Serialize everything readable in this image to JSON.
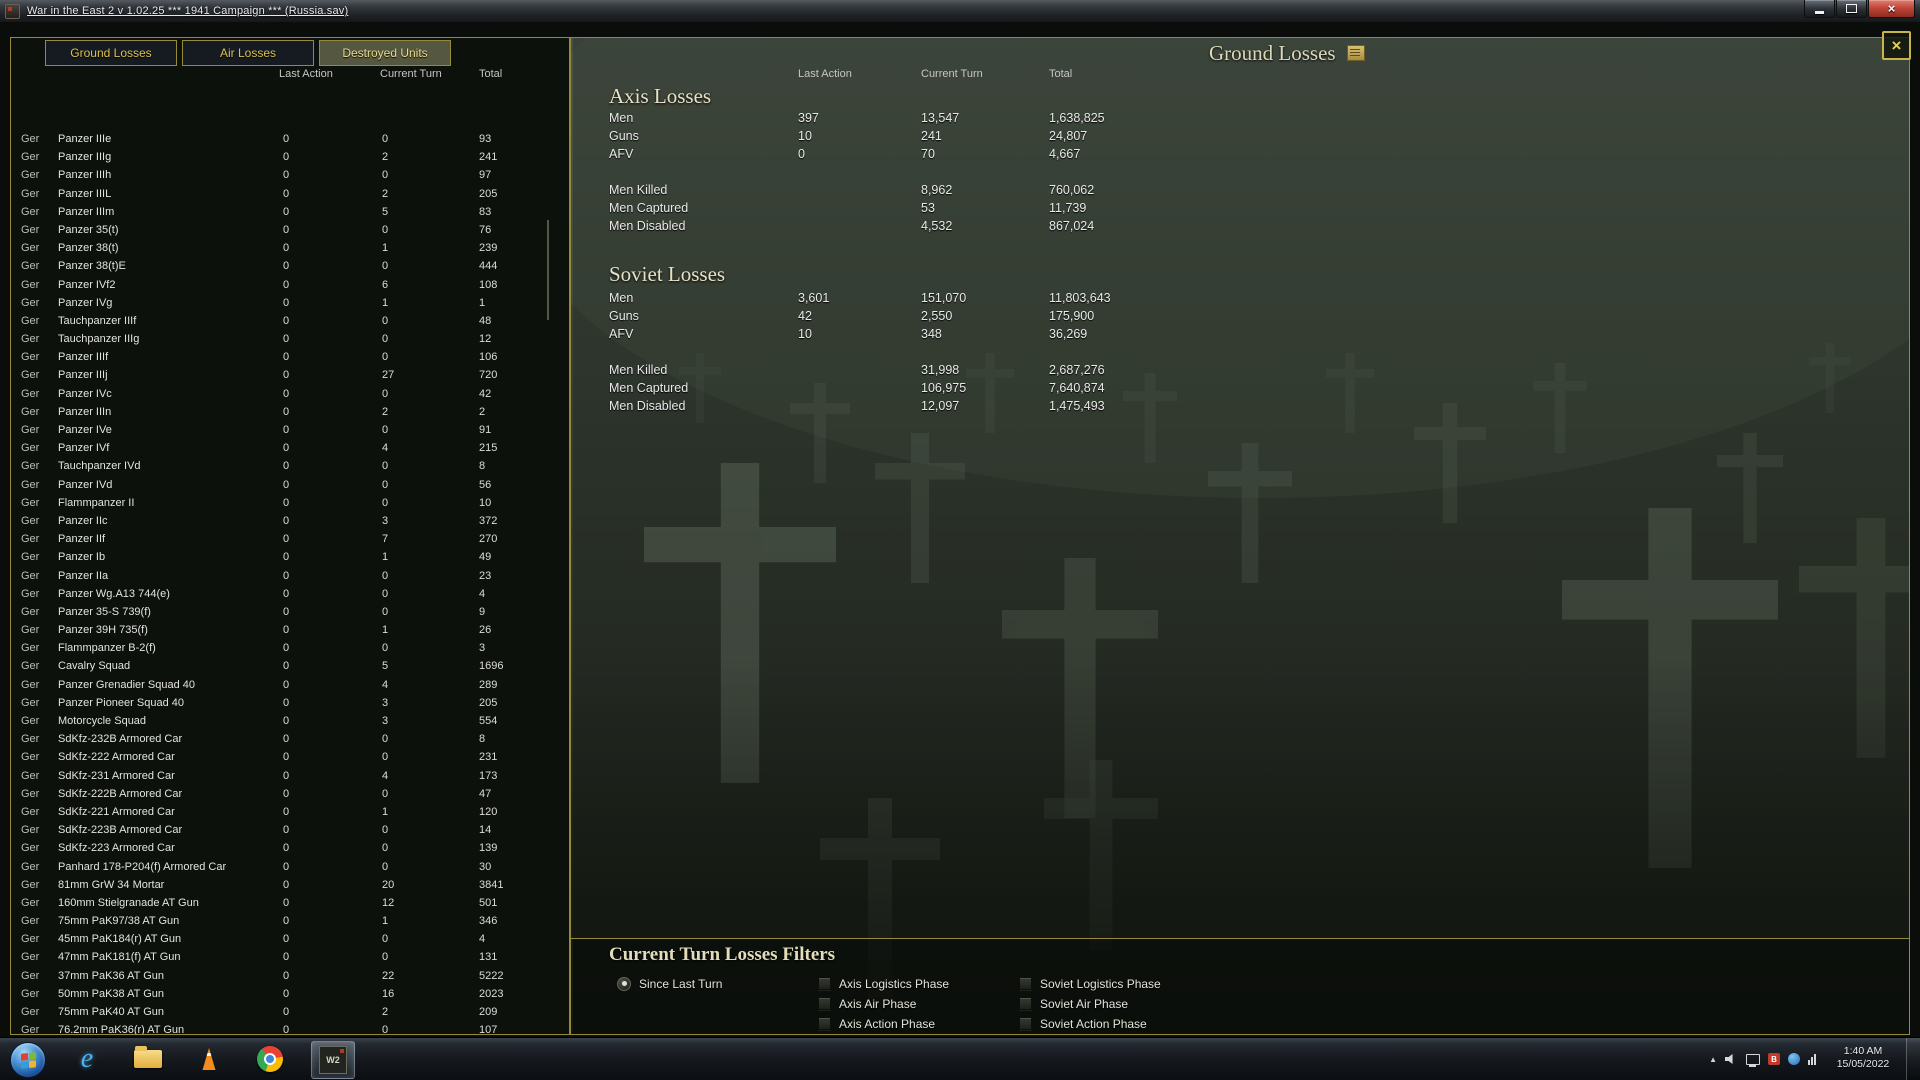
{
  "titlebar": {
    "title": "War in the East 2  v 1.02.25    ***    1941 Campaign    ***    (Russia.sav)"
  },
  "tabs": [
    "Ground Losses",
    "Air Losses",
    "Destroyed Units"
  ],
  "screen_title": "Ground Losses",
  "glyphs": {
    "screen_close": "×"
  },
  "left_table": {
    "headers": [
      "Last Action",
      "Current Turn",
      "Total"
    ],
    "rows": [
      [
        "Ger",
        "Panzer IIIe",
        "0",
        "0",
        "93"
      ],
      [
        "Ger",
        "Panzer IIIg",
        "0",
        "2",
        "241"
      ],
      [
        "Ger",
        "Panzer IIIh",
        "0",
        "0",
        "97"
      ],
      [
        "Ger",
        "Panzer IIIL",
        "0",
        "2",
        "205"
      ],
      [
        "Ger",
        "Panzer IIIm",
        "0",
        "5",
        "83"
      ],
      [
        "Ger",
        "Panzer 35(t)",
        "0",
        "0",
        "76"
      ],
      [
        "Ger",
        "Panzer 38(t)",
        "0",
        "1",
        "239"
      ],
      [
        "Ger",
        "Panzer 38(t)E",
        "0",
        "0",
        "444"
      ],
      [
        "Ger",
        "Panzer IVf2",
        "0",
        "6",
        "108"
      ],
      [
        "Ger",
        "Panzer IVg",
        "0",
        "1",
        "1"
      ],
      [
        "Ger",
        "Tauchpanzer IIIf",
        "0",
        "0",
        "48"
      ],
      [
        "Ger",
        "Tauchpanzer IIIg",
        "0",
        "0",
        "12"
      ],
      [
        "Ger",
        "Panzer IIIf",
        "0",
        "0",
        "106"
      ],
      [
        "Ger",
        "Panzer IIIj",
        "0",
        "27",
        "720"
      ],
      [
        "Ger",
        "Panzer IVc",
        "0",
        "0",
        "42"
      ],
      [
        "Ger",
        "Panzer IIIn",
        "0",
        "2",
        "2"
      ],
      [
        "Ger",
        "Panzer IVe",
        "0",
        "0",
        "91"
      ],
      [
        "Ger",
        "Panzer IVf",
        "0",
        "4",
        "215"
      ],
      [
        "Ger",
        "Tauchpanzer IVd",
        "0",
        "0",
        "8"
      ],
      [
        "Ger",
        "Panzer IVd",
        "0",
        "0",
        "56"
      ],
      [
        "Ger",
        "Flammpanzer II",
        "0",
        "0",
        "10"
      ],
      [
        "Ger",
        "Panzer IIc",
        "0",
        "3",
        "372"
      ],
      [
        "Ger",
        "Panzer IIf",
        "0",
        "7",
        "270"
      ],
      [
        "Ger",
        "Panzer Ib",
        "0",
        "1",
        "49"
      ],
      [
        "Ger",
        "Panzer IIa",
        "0",
        "0",
        "23"
      ],
      [
        "Ger",
        "Panzer Wg.A13 744(e)",
        "0",
        "0",
        "4"
      ],
      [
        "Ger",
        "Panzer 35-S 739(f)",
        "0",
        "0",
        "9"
      ],
      [
        "Ger",
        "Panzer 39H 735(f)",
        "0",
        "1",
        "26"
      ],
      [
        "Ger",
        "Flammpanzer B-2(f)",
        "0",
        "0",
        "3"
      ],
      [
        "Ger",
        "Cavalry Squad",
        "0",
        "5",
        "1696"
      ],
      [
        "Ger",
        "Panzer Grenadier Squad 40",
        "0",
        "4",
        "289"
      ],
      [
        "Ger",
        "Panzer Pioneer Squad 40",
        "0",
        "3",
        "205"
      ],
      [
        "Ger",
        "Motorcycle Squad",
        "0",
        "3",
        "554"
      ],
      [
        "Ger",
        "SdKfz-232B Armored Car",
        "0",
        "0",
        "8"
      ],
      [
        "Ger",
        "SdKfz-222 Armored Car",
        "0",
        "0",
        "231"
      ],
      [
        "Ger",
        "SdKfz-231 Armored Car",
        "0",
        "4",
        "173"
      ],
      [
        "Ger",
        "SdKfz-222B Armored Car",
        "0",
        "0",
        "47"
      ],
      [
        "Ger",
        "SdKfz-221 Armored Car",
        "0",
        "1",
        "120"
      ],
      [
        "Ger",
        "SdKfz-223B Armored Car",
        "0",
        "0",
        "14"
      ],
      [
        "Ger",
        "SdKfz-223 Armored Car",
        "0",
        "0",
        "139"
      ],
      [
        "Ger",
        "Panhard 178-P204(f) Armored Car",
        "0",
        "0",
        "30"
      ],
      [
        "Ger",
        "81mm GrW 34 Mortar",
        "0",
        "20",
        "3841"
      ],
      [
        "Ger",
        "160mm Stielgranade AT Gun",
        "0",
        "12",
        "501"
      ],
      [
        "Ger",
        "75mm PaK97/38 AT Gun",
        "0",
        "1",
        "346"
      ],
      [
        "Ger",
        "45mm PaK184(r) AT Gun",
        "0",
        "0",
        "4"
      ],
      [
        "Ger",
        "47mm PaK181(f) AT Gun",
        "0",
        "0",
        "131"
      ],
      [
        "Ger",
        "37mm PaK36 AT Gun",
        "0",
        "22",
        "5222"
      ],
      [
        "Ger",
        "50mm PaK38 AT Gun",
        "0",
        "16",
        "2023"
      ],
      [
        "Ger",
        "75mm PaK40 AT Gun",
        "0",
        "2",
        "209"
      ],
      [
        "Ger",
        "76.2mm PaK36(r) AT Gun",
        "0",
        "0",
        "107"
      ]
    ]
  },
  "losses": {
    "headers": [
      "Last Action",
      "Current Turn",
      "Total"
    ],
    "axis": {
      "title": "Axis Losses",
      "rows": [
        [
          "Men",
          "397",
          "13,547",
          "1,638,825"
        ],
        [
          "Guns",
          "10",
          "241",
          "24,807"
        ],
        [
          "AFV",
          "0",
          "70",
          "4,667"
        ],
        [
          "Men Killed",
          "",
          "8,962",
          "760,062"
        ],
        [
          "Men Captured",
          "",
          "53",
          "11,739"
        ],
        [
          "Men Disabled",
          "",
          "4,532",
          "867,024"
        ]
      ]
    },
    "soviet": {
      "title": "Soviet Losses",
      "rows": [
        [
          "Men",
          "3,601",
          "151,070",
          "11,803,643"
        ],
        [
          "Guns",
          "42",
          "2,550",
          "175,900"
        ],
        [
          "AFV",
          "10",
          "348",
          "36,269"
        ],
        [
          "Men Killed",
          "",
          "31,998",
          "2,687,276"
        ],
        [
          "Men Captured",
          "",
          "106,975",
          "7,640,874"
        ],
        [
          "Men Disabled",
          "",
          "12,097",
          "1,475,493"
        ]
      ]
    }
  },
  "filters": {
    "title": "Current Turn Losses Filters",
    "radio_label": "Since Last Turn",
    "left": [
      "Axis Logistics Phase",
      "Axis Air Phase",
      "Axis Action Phase"
    ],
    "right": [
      "Soviet Logistics Phase",
      "Soviet Air Phase",
      "Soviet Action Phase"
    ]
  },
  "taskbar": {
    "time": "1:40 AM",
    "date": "15/05/2022"
  },
  "icons": {
    "ie_letter": "e",
    "tray_chevron": "▲",
    "tray_red_letter": "B",
    "game_label": "W2"
  }
}
